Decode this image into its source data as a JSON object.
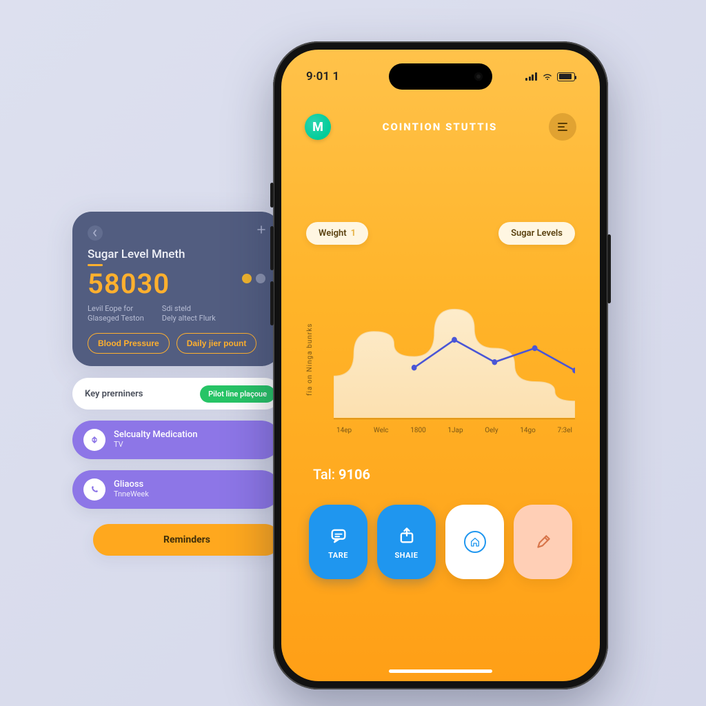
{
  "side": {
    "title": "Sugar Level Mneth",
    "value": "58030",
    "col1_l1": "Levil Eope for",
    "col1_l2": "Glaseged Teston",
    "col2_l1": "Sdi steld",
    "col2_l2": "Dely altect Flurk",
    "pill1": "Blood Pressure",
    "pill2": "Daily jier pount"
  },
  "rows": {
    "key_label": "Key prerniners",
    "key_badge": "Pilot line plaçoue",
    "med_l1": "Selcualty Medication",
    "med_l2": "TV",
    "glia_l1": "Gliaoss",
    "glia_l2": "TnneWeek",
    "cta": "Reminders"
  },
  "phone": {
    "time": "9·01 1",
    "logo_letter": "M",
    "title": "COINTION STUTTIS",
    "chip1": "Weight",
    "chip1_num": "1",
    "chip2": "Sugar Levels",
    "ylabel": "fia on Ninga bunrks",
    "xticks": [
      "14ep",
      "Welc",
      "1800",
      "1Jap",
      "Oely",
      "14go",
      "7:3el"
    ],
    "tal_label": "Tal:",
    "tal_value": "9106",
    "act1": "TARE",
    "act2": "SHAIE"
  },
  "chart_data": {
    "type": "line",
    "title": "",
    "xlabel": "",
    "ylabel": "fia on Ninga bunrks",
    "categories": [
      "14ep",
      "Welc",
      "1800",
      "1Jap",
      "Oely",
      "14go",
      "7:3el"
    ],
    "series": [
      {
        "name": "area",
        "values": [
          30,
          62,
          44,
          78,
          50,
          26,
          12
        ]
      },
      {
        "name": "line",
        "values": [
          null,
          null,
          36,
          56,
          40,
          50,
          34
        ]
      }
    ],
    "ylim": [
      0,
      100
    ]
  }
}
